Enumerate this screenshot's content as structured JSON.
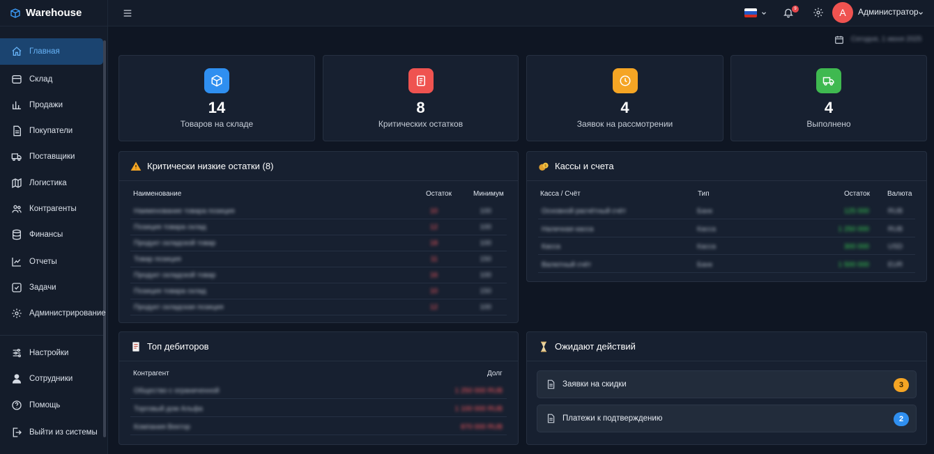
{
  "app": {
    "title": "Warehouse"
  },
  "sidebar": {
    "items": [
      {
        "label": "Главная",
        "icon": "home-icon",
        "active": true
      },
      {
        "label": "Склад",
        "icon": "box-icon"
      },
      {
        "label": "Продажи",
        "icon": "bar-chart-icon"
      },
      {
        "label": "Покупатели",
        "icon": "document-icon"
      },
      {
        "label": "Поставщики",
        "icon": "truck-icon"
      },
      {
        "label": "Логистика",
        "icon": "map-icon"
      },
      {
        "label": "Контрагенты",
        "icon": "users-icon"
      },
      {
        "label": "Финансы",
        "icon": "database-icon"
      },
      {
        "label": "Отчеты",
        "icon": "line-chart-icon"
      },
      {
        "label": "Задачи",
        "icon": "checkbox-icon"
      },
      {
        "label": "Администрирование",
        "icon": "gear-icon"
      }
    ],
    "bottom_items": [
      {
        "label": "Настройки",
        "icon": "sliders-icon"
      },
      {
        "label": "Сотрудники",
        "icon": "person-icon"
      },
      {
        "label": "Помощь",
        "icon": "help-icon"
      },
      {
        "label": "Выйти из системы",
        "icon": "logout-icon"
      }
    ]
  },
  "header": {
    "notifications_count": "9",
    "user_initial": "A",
    "user_name": "Администратор",
    "date_text": "Сегодня, 1 июня 2025"
  },
  "stats": [
    {
      "value": "14",
      "label": "Товаров на складе",
      "color": "#2f8ff0",
      "icon": "cube-icon"
    },
    {
      "value": "8",
      "label": "Критических остатков",
      "color": "#ef5350",
      "icon": "clipboard-icon"
    },
    {
      "value": "4",
      "label": "Заявок на рассмотрении",
      "color": "#f5a524",
      "icon": "clock-icon"
    },
    {
      "value": "4",
      "label": "Выполнено",
      "color": "#3fb950",
      "icon": "truck-icon"
    }
  ],
  "low_stock": {
    "title": "Критически низкие остатки (8)",
    "columns": [
      "Наименование",
      "Остаток",
      "Минимум"
    ],
    "rows": [
      {
        "name": "Наименование товара позиция",
        "stock": "10",
        "min": "100"
      },
      {
        "name": "Позиция товара склад",
        "stock": "12",
        "min": "100"
      },
      {
        "name": "Продукт складской товар",
        "stock": "18",
        "min": "100"
      },
      {
        "name": "Товар позиция",
        "stock": "11",
        "min": "150"
      },
      {
        "name": "Продукт складской товар",
        "stock": "16",
        "min": "100"
      },
      {
        "name": "Позиция товара склад",
        "stock": "10",
        "min": "150"
      },
      {
        "name": "Продукт складская позиция",
        "stock": "12",
        "min": "100"
      }
    ]
  },
  "cash": {
    "title": "Кассы и счета",
    "columns": [
      "Касса / Счёт",
      "Тип",
      "Остаток",
      "Валюта"
    ],
    "rows": [
      {
        "name": "Основной расчётный счёт",
        "type": "Банк",
        "balance": "125 000",
        "currency": "RUB"
      },
      {
        "name": "Наличная касса",
        "type": "Касса",
        "balance": "1 250 000",
        "currency": "RUB"
      },
      {
        "name": "Касса",
        "type": "Касса",
        "balance": "300 000",
        "currency": "USD"
      },
      {
        "name": "Валютный счёт",
        "type": "Банк",
        "balance": "1 500 000",
        "currency": "EUR"
      }
    ]
  },
  "debtors": {
    "title": "Топ дебиторов",
    "columns": [
      "Контрагент",
      "Долг"
    ],
    "rows": [
      {
        "name": "Общество с ограниченной",
        "debt": "1 250 000 RUB"
      },
      {
        "name": "Торговый дом Альфа",
        "debt": "1 100 000 RUB"
      },
      {
        "name": "Компания Вектор",
        "debt": "870 000 RUB"
      }
    ]
  },
  "pending": {
    "title": "Ожидают действий",
    "items": [
      {
        "label": "Заявки на скидки",
        "count": "3",
        "color": "#f5a524"
      },
      {
        "label": "Платежи к подтверждению",
        "count": "2",
        "color": "#2f8ff0"
      }
    ]
  },
  "colors": {
    "accent": "#67b3f7",
    "danger": "#ff5a5f",
    "success": "#39d353"
  }
}
